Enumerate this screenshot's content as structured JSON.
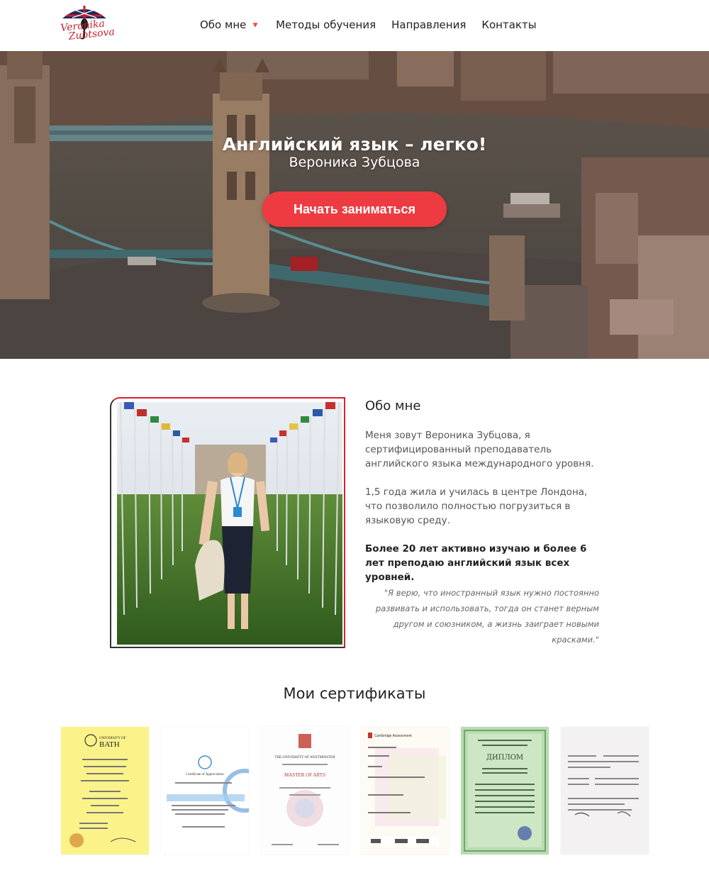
{
  "logo": {
    "line1": "Veronika",
    "line2": "Zubtsova"
  },
  "nav": {
    "items": [
      {
        "label": "Обо мне",
        "has_caret": true
      },
      {
        "label": "Методы обучения"
      },
      {
        "label": "Направления"
      },
      {
        "label": "Контакты"
      }
    ],
    "caret": "🔻"
  },
  "hero": {
    "title": "Английский язык – легко!",
    "subtitle": "Вероника Зубцова",
    "button_label": "Начать заниматься",
    "accent_color": "#ee3b41"
  },
  "about": {
    "title": "Обо мне",
    "p1": "Меня зовут Вероника Зубцова, я сертифицированный преподаватель английского языка международного уровня.",
    "p2": "1,5 года жила и училась в центре Лондона, что позволило полностью погрузиться в языковую среду.",
    "p3": "Более 20 лет активно изучаю и более 6 лет преподаю английский язык всех уровней.",
    "quote": "\"Я верю, что иностранный язык нужно постоянно развивать и использовать, тогда он станет верным другом и союзником, а жизнь заиграет новыми красками.\""
  },
  "certificates": {
    "title": "Мои сертификаты",
    "items": [
      {
        "name": "bath",
        "heading": "UNIVERSITY OF BATH",
        "sub": "Veronika ZUBTSOVA",
        "bg": "#fbf38a"
      },
      {
        "name": "un",
        "heading": "Certificate of Appreciation",
        "sub": "Ms. Veronika Alexandrovna ZUBTSOVA",
        "bg": "#ffffff"
      },
      {
        "name": "westminster",
        "heading": "THE UNIVERSITY OF WESTMINSTER",
        "sub": "MASTER OF ARTS",
        "bg": "#ffffff"
      },
      {
        "name": "cambridge",
        "heading": "Cambridge Assessment English",
        "sub": "VERONIKA ZUBTSOVA",
        "bg": "#fdfbf3"
      },
      {
        "name": "diplom",
        "heading": "ДИПЛОМ",
        "sub": "ЗУБЦОВА ВЕРОНИКА АЛЕКСАНДРОВНА",
        "bg": "#b9dcb2"
      },
      {
        "name": "form",
        "heading": "",
        "sub": "",
        "bg": "#f4f1f3"
      }
    ]
  }
}
